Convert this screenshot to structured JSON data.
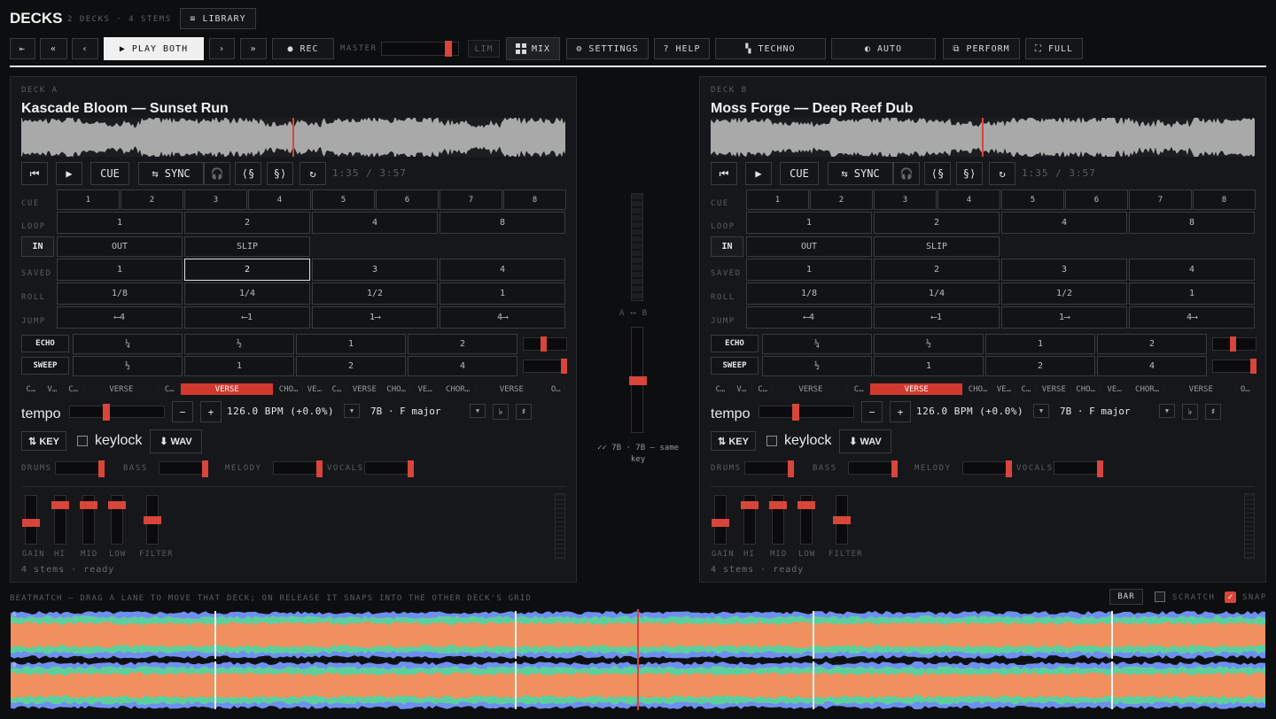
{
  "header": {
    "title": "DECKS",
    "subtitle": "2 DECKS · 4 STEMS",
    "library_label": "≡ LIBRARY"
  },
  "toolbar": {
    "first": "⇤",
    "rewind": "«",
    "prev": "‹",
    "play_both": "▶ PLAY BOTH",
    "next": "›",
    "fast_forward": "»",
    "rec": "● REC",
    "master_label": "MASTER",
    "master_level": 0.85,
    "lim": "LIM",
    "mix": "MIX",
    "settings": "⚙ SETTINGS",
    "help": "? HELP",
    "genre": "▚ TECHNO",
    "auto": "◐ AUTO",
    "perform": "⧉ PERFORM",
    "full": "⛶ FULL"
  },
  "decks": [
    {
      "label": "DECK A",
      "title": "Kascade Bloom — Sunset Run",
      "playhead": 0.5,
      "time": "1:35 / 3:57",
      "cue_label": "CUE",
      "sync_label": "⇆ SYNC",
      "row_labels": {
        "cue": "CUE",
        "loop": "LOOP",
        "saved": "SAVED",
        "roll": "ROLL",
        "jump": "JUMP"
      },
      "cue_pads": [
        "1",
        "2",
        "3",
        "4",
        "5",
        "6",
        "7",
        "8"
      ],
      "loop_pads": [
        "1",
        "2",
        "4",
        "8"
      ],
      "in_label": "IN",
      "out_label": "OUT",
      "slip_label": "SLIP",
      "saved_pads": [
        "1",
        "2",
        "3",
        "4"
      ],
      "saved_selected": 1,
      "roll_pads": [
        "1/8",
        "1/4",
        "1/2",
        "1"
      ],
      "jump_pads": [
        "⟵4",
        "⟵1",
        "1⟶",
        "4⟶"
      ],
      "echo_label": "ECHO",
      "echo_pads": [
        "¼",
        "½",
        "1",
        "2"
      ],
      "echo_level": 0.45,
      "sweep_label": "SWEEP",
      "sweep_pads": [
        "½",
        "1",
        "2",
        "4"
      ],
      "sweep_level": 0.92,
      "sections": [
        "C…",
        "V…",
        "C…",
        "VERSE",
        "C…",
        "VERSE",
        "CHO…",
        "VE…",
        "C…",
        "VERSE",
        "CHO…",
        "VE…",
        "CHOR…",
        "VERSE",
        "O…"
      ],
      "section_active": 5,
      "tempo_label": "tempo",
      "tempo_level": 0.38,
      "bpm": "126.0 BPM (+0.0%)",
      "key": "7B · F major",
      "key_btn": "⇅ KEY",
      "keylock_label": "keylock",
      "wav_label": "⬇ WAV",
      "stems": [
        {
          "name": "DRUMS",
          "level": 0.92
        },
        {
          "name": "BASS",
          "level": 0.92
        },
        {
          "name": "MELODY",
          "level": 0.92
        },
        {
          "name": "VOCALS",
          "level": 0.92
        }
      ],
      "eq": [
        {
          "name": "GAIN",
          "level": 0.45
        },
        {
          "name": "HI",
          "level": 0.8
        },
        {
          "name": "MID",
          "level": 0.8
        },
        {
          "name": "LOW",
          "level": 0.8
        },
        {
          "name": "FILTER",
          "level": 0.5
        }
      ],
      "status": "4 stems · ready"
    },
    {
      "label": "DECK B",
      "title": "Moss Forge — Deep Reef Dub",
      "playhead": 0.5,
      "time": "1:35 / 3:57",
      "cue_label": "CUE",
      "sync_label": "⇆ SYNC",
      "row_labels": {
        "cue": "CUE",
        "loop": "LOOP",
        "saved": "SAVED",
        "roll": "ROLL",
        "jump": "JUMP"
      },
      "cue_pads": [
        "1",
        "2",
        "3",
        "4",
        "5",
        "6",
        "7",
        "8"
      ],
      "loop_pads": [
        "1",
        "2",
        "4",
        "8"
      ],
      "in_label": "IN",
      "out_label": "OUT",
      "slip_label": "SLIP",
      "saved_pads": [
        "1",
        "2",
        "3",
        "4"
      ],
      "saved_selected": -1,
      "roll_pads": [
        "1/8",
        "1/4",
        "1/2",
        "1"
      ],
      "jump_pads": [
        "⟵4",
        "⟵1",
        "1⟶",
        "4⟶"
      ],
      "echo_label": "ECHO",
      "echo_pads": [
        "¼",
        "½",
        "1",
        "2"
      ],
      "echo_level": 0.45,
      "sweep_label": "SWEEP",
      "sweep_pads": [
        "½",
        "1",
        "2",
        "4"
      ],
      "sweep_level": 0.92,
      "sections": [
        "C…",
        "V…",
        "C…",
        "VERSE",
        "C…",
        "VERSE",
        "CHO…",
        "VE…",
        "C…",
        "VERSE",
        "CHO…",
        "VE…",
        "CHOR…",
        "VERSE",
        "O…"
      ],
      "section_active": 5,
      "tempo_label": "tempo",
      "tempo_level": 0.38,
      "bpm": "126.0 BPM (+0.0%)",
      "key": "7B · F major",
      "key_btn": "⇅ KEY",
      "keylock_label": "keylock",
      "wav_label": "⬇ WAV",
      "stems": [
        {
          "name": "DRUMS",
          "level": 0.92
        },
        {
          "name": "BASS",
          "level": 0.92
        },
        {
          "name": "MELODY",
          "level": 0.92
        },
        {
          "name": "VOCALS",
          "level": 0.92
        }
      ],
      "eq": [
        {
          "name": "GAIN",
          "level": 0.45
        },
        {
          "name": "HI",
          "level": 0.8
        },
        {
          "name": "MID",
          "level": 0.8
        },
        {
          "name": "LOW",
          "level": 0.8
        },
        {
          "name": "FILTER",
          "level": 0.5
        }
      ],
      "status": "4 stems · ready"
    }
  ],
  "mixer": {
    "crossfader_label": "A ⟷ B",
    "crossfader_level": 0.5,
    "key_match": "✓✓ 7B · 7B — same key"
  },
  "beatmatch": {
    "hint": "BEATMATCH — DRAG A LANE TO MOVE THAT DECK; ON RELEASE IT SNAPS INTO THE OTHER DECK'S GRID",
    "bar_label": "BAR",
    "scratch_label": "SCRATCH",
    "scratch_checked": false,
    "snap_label": "SNAP",
    "snap_checked": true,
    "lane_a": "A",
    "lane_b": "B",
    "playhead": 0.5
  },
  "colors": {
    "accent": "#d8453a",
    "stem_drums": "#5dcf9c",
    "stem_bass": "#f0905e",
    "stem_melody": "#6f8ff0",
    "waveform": "#a9a9a9"
  }
}
